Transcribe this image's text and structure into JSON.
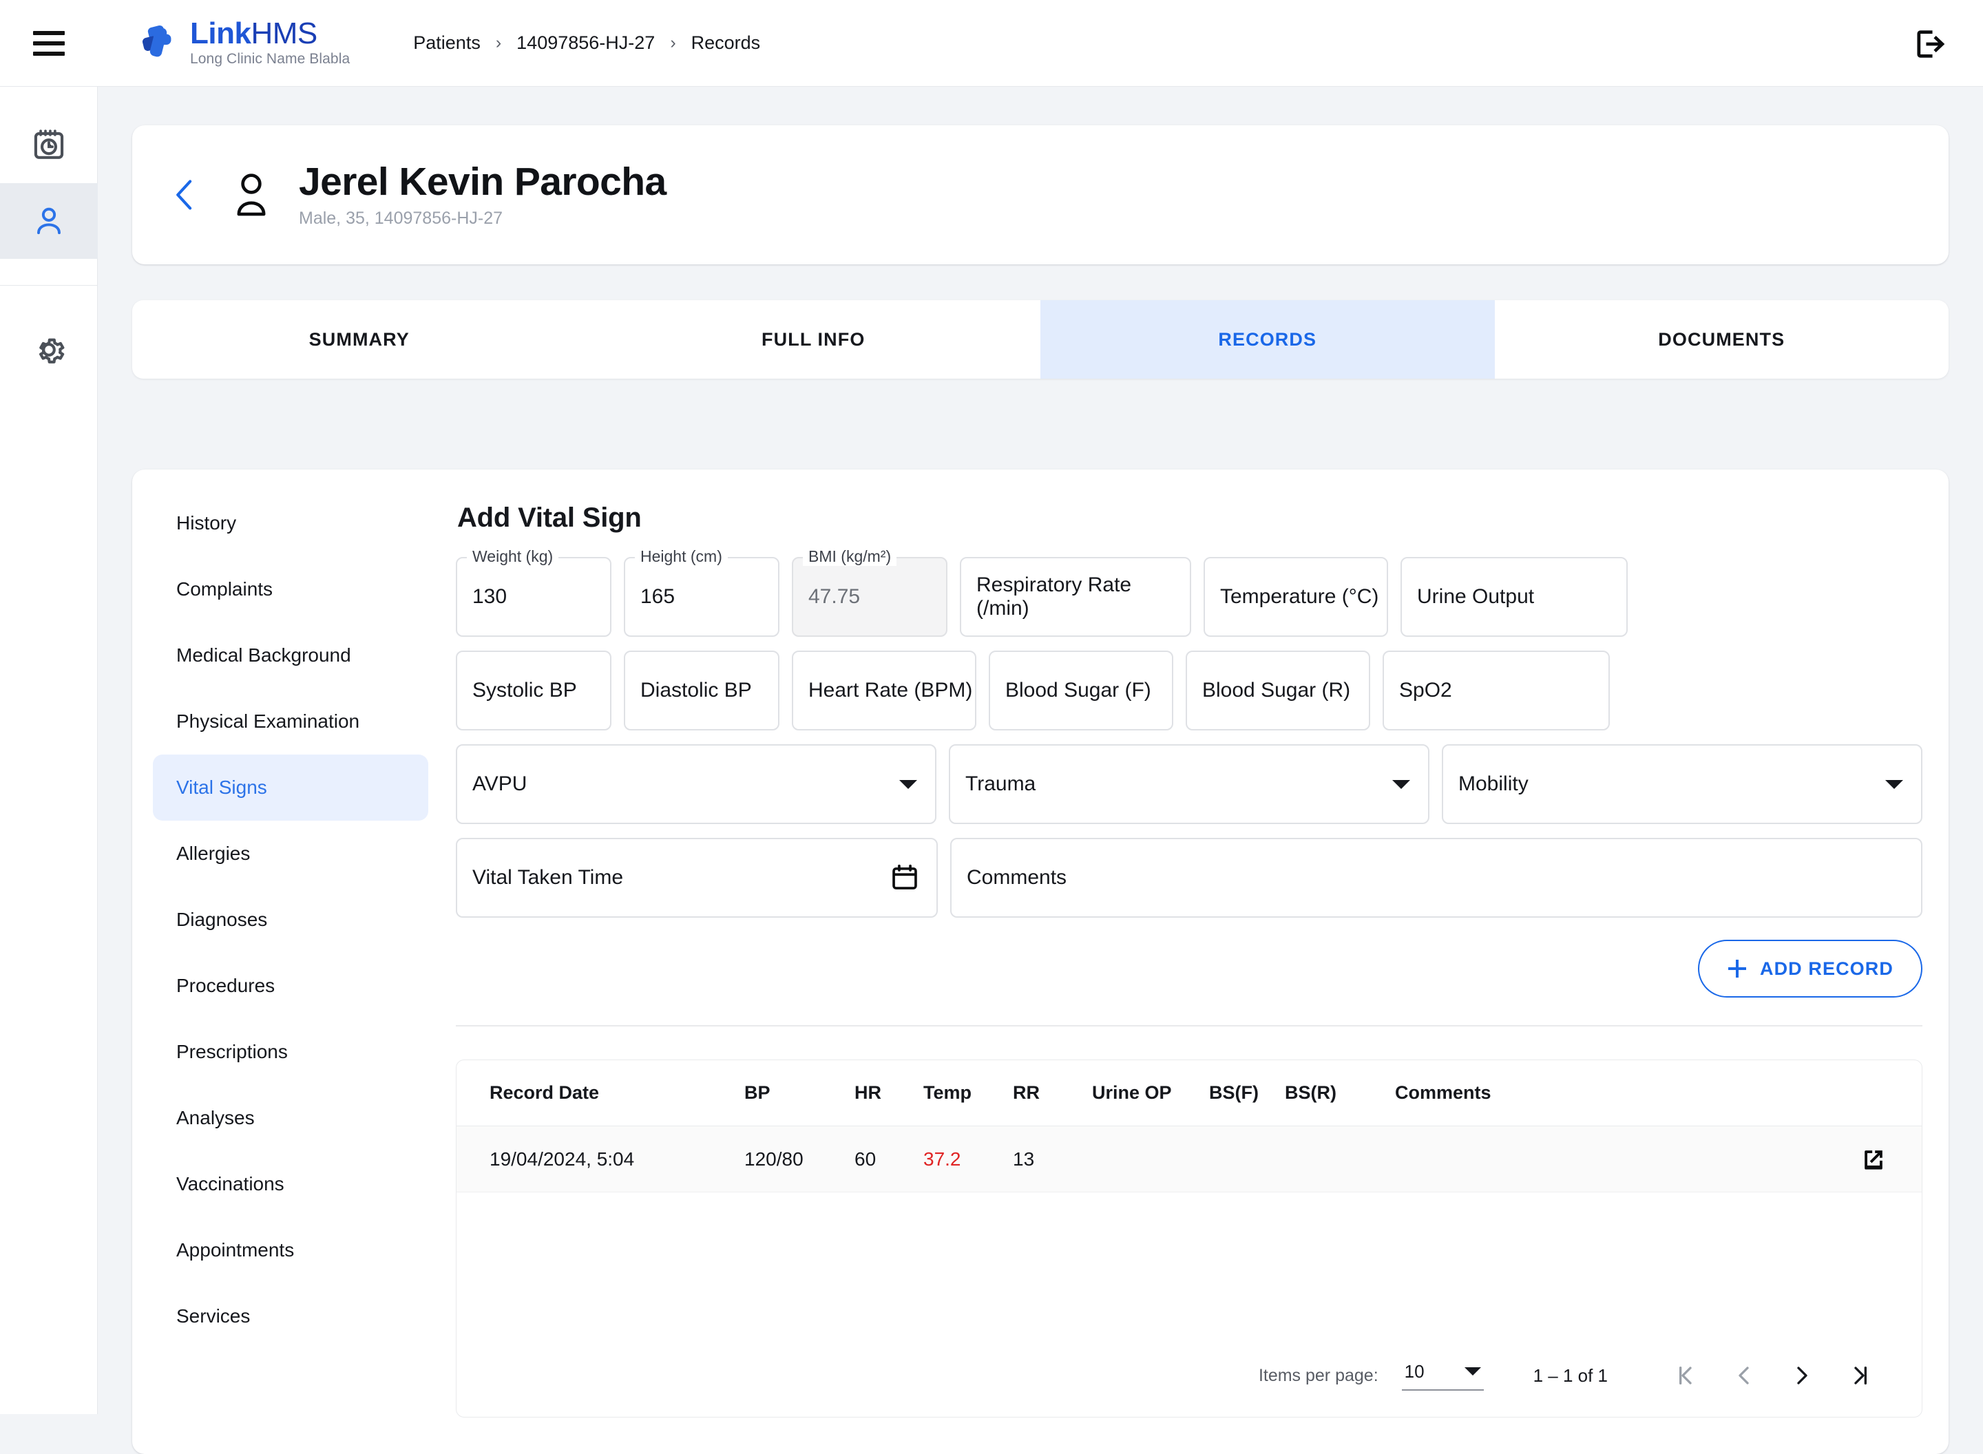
{
  "header": {
    "menu_icon": "hamburger-icon",
    "brand_part1": "Link",
    "brand_part2": "HMS",
    "brand_subtitle": "Long Clinic Name Blabla",
    "logout_icon": "logout-icon",
    "breadcrumb": [
      "Patients",
      "14097856-HJ-27",
      "Records"
    ],
    "breadcrumb_separator": "›"
  },
  "rail": {
    "items": [
      {
        "icon": "calendar-clock-icon",
        "active": false
      },
      {
        "icon": "person-icon",
        "active": true
      },
      {
        "icon": "gear-icon",
        "active": false
      }
    ]
  },
  "patient": {
    "back_icon": "chevron-left-icon",
    "avatar_icon": "person-icon",
    "name": "Jerel Kevin Parocha",
    "subtitle": "Male, 35, 14097856-HJ-27"
  },
  "tabs": [
    {
      "label": "SUMMARY",
      "active": false
    },
    {
      "label": "FULL INFO",
      "active": false
    },
    {
      "label": "RECORDS",
      "active": true
    },
    {
      "label": "DOCUMENTS",
      "active": false
    }
  ],
  "section_nav": [
    {
      "label": "History",
      "active": false
    },
    {
      "label": "Complaints",
      "active": false
    },
    {
      "label": "Medical Background",
      "active": false
    },
    {
      "label": "Physical Examination",
      "active": false
    },
    {
      "label": "Vital Signs",
      "active": true
    },
    {
      "label": "Allergies",
      "active": false
    },
    {
      "label": "Diagnoses",
      "active": false
    },
    {
      "label": "Procedures",
      "active": false
    },
    {
      "label": "Prescriptions",
      "active": false
    },
    {
      "label": "Analyses",
      "active": false
    },
    {
      "label": "Vaccinations",
      "active": false
    },
    {
      "label": "Appointments",
      "active": false
    },
    {
      "label": "Services",
      "active": false
    }
  ],
  "form": {
    "title": "Add Vital Sign",
    "weight": {
      "label": "Weight (kg)",
      "value": "130"
    },
    "height": {
      "label": "Height (cm)",
      "value": "165"
    },
    "bmi": {
      "label": "BMI (kg/m²)",
      "value": "47.75",
      "disabled": "true"
    },
    "respiratory_rate": {
      "placeholder": "Respiratory Rate (/min)",
      "value": ""
    },
    "temperature": {
      "placeholder": "Temperature (°C)",
      "value": ""
    },
    "urine_output": {
      "placeholder": "Urine Output",
      "value": ""
    },
    "systolic_bp": {
      "placeholder": "Systolic BP",
      "value": ""
    },
    "diastolic_bp": {
      "placeholder": "Diastolic BP",
      "value": ""
    },
    "heart_rate": {
      "placeholder": "Heart Rate (BPM)",
      "value": ""
    },
    "blood_sugar_f": {
      "placeholder": "Blood Sugar (F)",
      "value": ""
    },
    "blood_sugar_r": {
      "placeholder": "Blood Sugar (R)",
      "value": ""
    },
    "spo2": {
      "placeholder": "SpO2",
      "value": ""
    },
    "avpu": {
      "placeholder": "AVPU",
      "value": ""
    },
    "trauma": {
      "placeholder": "Trauma",
      "value": ""
    },
    "mobility": {
      "placeholder": "Mobility",
      "value": ""
    },
    "vital_taken_time": {
      "placeholder": "Vital Taken Time",
      "value": "",
      "icon": "calendar-icon"
    },
    "comments": {
      "placeholder": "Comments",
      "value": ""
    },
    "add_record_label": "ADD RECORD",
    "add_record_icon": "plus-icon"
  },
  "table": {
    "columns": [
      "Record Date",
      "BP",
      "HR",
      "Temp",
      "RR",
      "Urine OP",
      "BS(F)",
      "BS(R)",
      "Comments"
    ],
    "rows": [
      {
        "record_date": "19/04/2024, 5:04",
        "bp": "120/80",
        "hr": "60",
        "temp": "37.2",
        "temp_abnormal": "true",
        "rr": "13",
        "urine_op": "",
        "bs_f": "",
        "bs_r": "",
        "comments": "",
        "action_icon": "open-in-new-icon"
      }
    ]
  },
  "paginator": {
    "items_per_page_label": "Items per page:",
    "items_per_page_value": "10",
    "range_label": "1 – 1 of 1",
    "first_icon": "first-page-icon",
    "prev_icon": "previous-page-icon",
    "next_icon": "next-page-icon",
    "last_icon": "last-page-icon"
  },
  "colors": {
    "accent": "#1a68e8",
    "accent_soft": "#e2ecfd",
    "brand_blue": "#1f56d6",
    "brand_dark": "#1a3fb5",
    "danger": "#e02424",
    "page_bg": "#f2f4f7"
  }
}
